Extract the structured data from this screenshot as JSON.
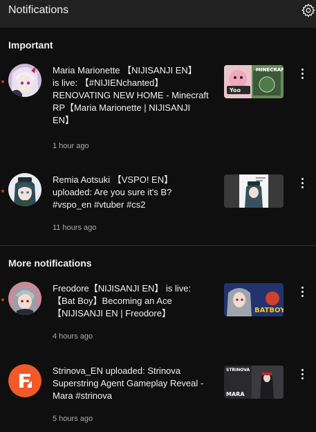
{
  "header": {
    "title": "Notifications",
    "settings_icon": "gear-icon"
  },
  "sections": [
    {
      "title": "Important",
      "items": [
        {
          "channel": "Maria Marionette",
          "text": "Maria Marionette 【NIJISANJI EN】\nis live: 【#NIJIENchanted】\nRENOVATING NEW HOME - Minecraft\nRP【Maria Marionette | NIJISANJI\nEN】",
          "time": "1 hour ago",
          "unread": true,
          "thumbnail_text": "MINECRAFT"
        },
        {
          "channel": "Remia Aotsuki",
          "text": "Remia Aotsuki 【VSPO! EN】\nuploaded: Are you sure it's B?\n#vspo_en #vtuber #cs2",
          "time": "11 hours ago",
          "unread": true,
          "thumbnail_text": ""
        }
      ]
    },
    {
      "title": "More notifications",
      "items": [
        {
          "channel": "Freodore",
          "text": "Freodore【NIJISANJI EN】 is live:\n【Bat Boy】Becoming an Ace\n【NIJISANJI EN | Freodore】",
          "time": "4 hours ago",
          "unread": true,
          "thumbnail_text": "BATBOY"
        },
        {
          "channel": "Strinova_EN",
          "text": "Strinova_EN uploaded: Strinova\nSuperstring Agent Gameplay Reveal -\nMara #strinova",
          "time": "5 hours ago",
          "unread": false,
          "thumbnail_text_top": "STRINOVA",
          "thumbnail_text_bottom": "MARA"
        }
      ]
    }
  ],
  "colors": {
    "background": "#0f0f0f",
    "header": "#212121",
    "unread_dot": "#d32f2f",
    "secondary_text": "#aaaaaa",
    "strinova_orange": "#f05a28"
  }
}
